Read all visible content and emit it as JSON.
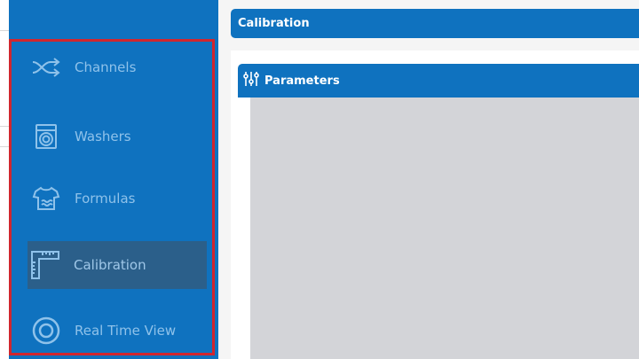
{
  "sidebar": {
    "items": [
      {
        "label": "Channels",
        "icon": "shuffle-icon",
        "active": false
      },
      {
        "label": "Washers",
        "icon": "washing-machine-icon",
        "active": false
      },
      {
        "label": "Formulas",
        "icon": "shirt-icon",
        "active": false
      },
      {
        "label": "Calibration",
        "icon": "ruler-icon",
        "active": true
      },
      {
        "label": "Real Time View",
        "icon": "eye-icon",
        "active": false
      }
    ]
  },
  "header": {
    "title": "Calibration"
  },
  "panel": {
    "title": "Parameters",
    "icon": "sliders-icon"
  },
  "colors": {
    "sidebar": "#0f72bf",
    "active_item": "#2b5f8a",
    "highlight_border": "#d0262e",
    "panel_body": "#d3d4d8"
  }
}
